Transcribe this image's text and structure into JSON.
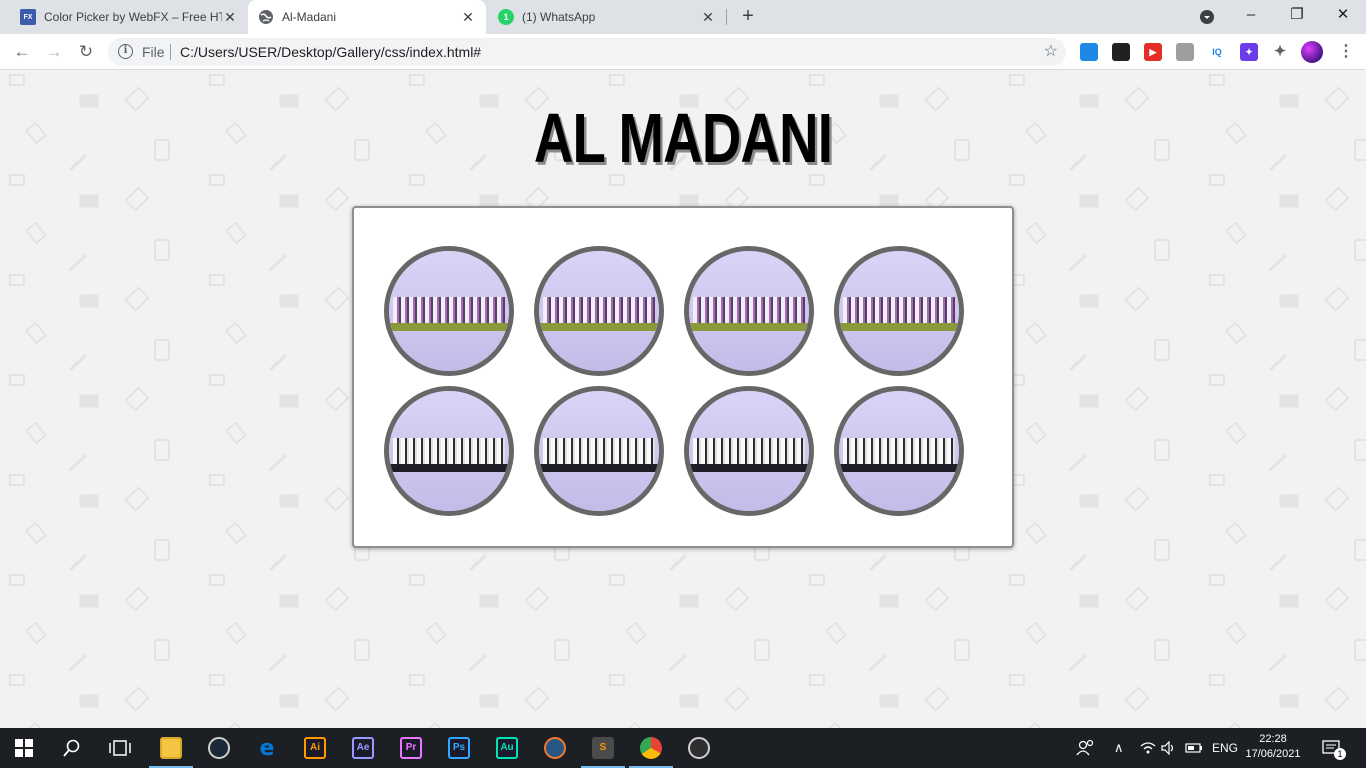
{
  "browser": {
    "tabs": [
      {
        "title": "Color Picker by WebFX – Free HT",
        "favicon": "FX",
        "active": false
      },
      {
        "title": "Al-Madani",
        "active": true
      },
      {
        "title": "(1) WhatsApp",
        "favicon_badge": "1",
        "active": false
      }
    ],
    "new_tab_symbol": "+",
    "close_symbol": "✕",
    "omnibox": {
      "scheme_label": "File",
      "url": "C:/Users/USER/Desktop/Gallery/css/index.html#"
    },
    "extensions": [
      {
        "name": "box-extension-icon",
        "color": "#1e88e5",
        "text": ""
      },
      {
        "name": "cube-extension-icon",
        "color": "#212121",
        "text": ""
      },
      {
        "name": "youtube-extension-icon",
        "color": "#e52d27",
        "text": "▶"
      },
      {
        "name": "chat-extension-icon",
        "color": "#9e9e9e",
        "text": ""
      },
      {
        "name": "iq-extension-icon",
        "color": "#ffffff",
        "text": "IQ"
      },
      {
        "name": "star-extension-icon",
        "color": "#6a3de8",
        "text": "✦"
      }
    ]
  },
  "page": {
    "title": "AL MADANI",
    "gallery_images": 8
  },
  "taskbar": {
    "apps": [
      {
        "name": "file-explorer",
        "label": "",
        "color": "#f4c542",
        "active": true
      },
      {
        "name": "steam",
        "label": "",
        "color": "#1b2838",
        "active": false
      },
      {
        "name": "edge",
        "label": "e",
        "color": "#0078d7",
        "active": false
      },
      {
        "name": "illustrator",
        "label": "Ai",
        "color": "#ff9a00",
        "active": false
      },
      {
        "name": "after-effects",
        "label": "Ae",
        "color": "#9999ff",
        "active": false
      },
      {
        "name": "premiere",
        "label": "Pr",
        "color": "#ea77ff",
        "active": false
      },
      {
        "name": "photoshop",
        "label": "Ps",
        "color": "#31a8ff",
        "active": false
      },
      {
        "name": "audition",
        "label": "Au",
        "color": "#00e4bb",
        "active": false
      },
      {
        "name": "blender",
        "label": "",
        "color": "#f5792a",
        "active": false
      },
      {
        "name": "sublime-text",
        "label": "S",
        "color": "#ff9800",
        "active": true
      },
      {
        "name": "chrome",
        "label": "",
        "color": "#4285f4",
        "active": true
      },
      {
        "name": "obs",
        "label": "",
        "color": "#302e31",
        "active": false
      }
    ],
    "tray": {
      "language": "ENG",
      "time": "22:28",
      "date": "17/06/2021",
      "notification_count": "1"
    }
  }
}
